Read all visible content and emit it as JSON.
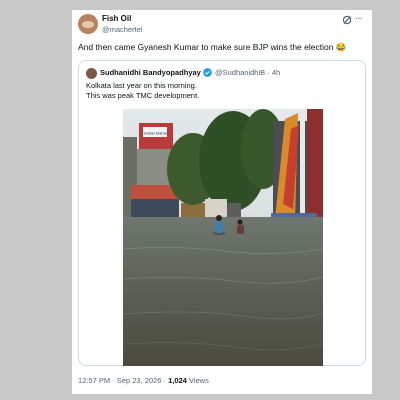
{
  "tweet": {
    "author_name": "Fish Oil",
    "author_handle": "@machertel",
    "text": "And then came Gyanesh Kumar to make sure BJP wins the election 😂",
    "more_symbol": "···"
  },
  "quote": {
    "author_name": "Sudhanidhi Bandyopadhyay",
    "author_handle": "@SudhanidhiB",
    "separator": "·",
    "time_ago": "4h",
    "line1": "Kolkata last year on this morning.",
    "line2": "This was peak TMC development."
  },
  "photo": {
    "billboard_text": "Yellow Mahal"
  },
  "meta": {
    "time": "12:57 PM",
    "date": "Sep 23, 2026",
    "views_count": "1,024",
    "views_label": "Views"
  },
  "colors": {
    "accent": "#1d9bf0",
    "text": "#0f1419",
    "muted": "#536471",
    "border": "#cfd9de",
    "background": "#c9c9c9"
  },
  "icons": [
    "grok-icon",
    "more-icon",
    "verified-icon"
  ]
}
